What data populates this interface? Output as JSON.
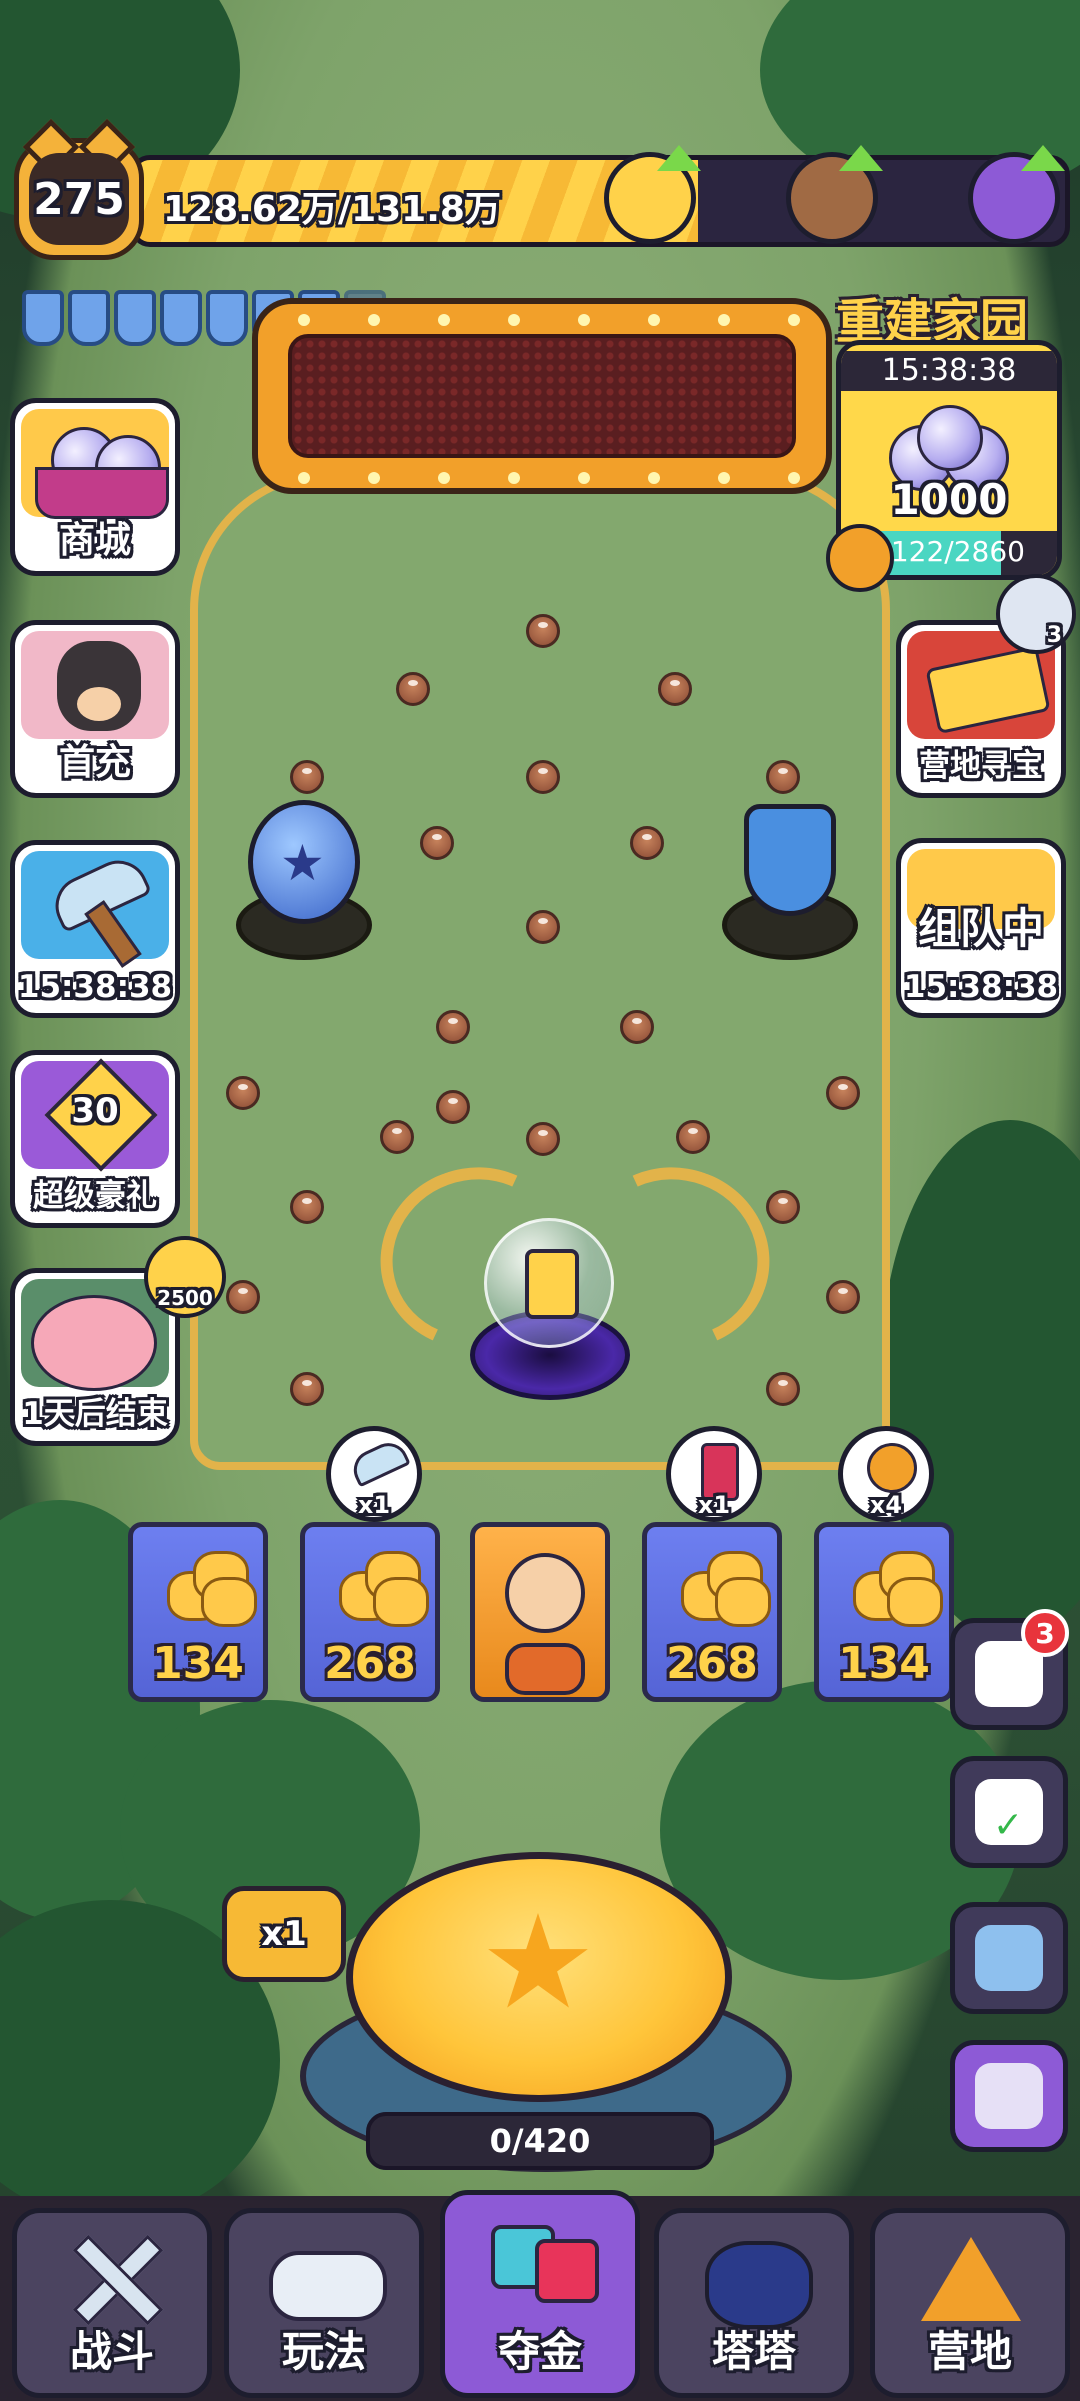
{
  "player": {
    "level": "275"
  },
  "xp": {
    "text": "128.62万/131.8万",
    "fraction": 0.976
  },
  "shields": {
    "total": 8,
    "active": 7
  },
  "side_left": [
    {
      "label": "商城",
      "icon": "gem-basket-icon"
    },
    {
      "label": "首充",
      "icon": "dog-character-icon"
    },
    {
      "label": "15:38:38",
      "icon": "hammer-icon"
    },
    {
      "label": "超级豪礼",
      "icon": "level-30-gift-icon",
      "level": "30"
    },
    {
      "label": "1天后结束",
      "icon": "piggy-bank-icon",
      "bubble": "2500"
    }
  ],
  "rebuild": {
    "title": "重建家园",
    "timer": "15:38:38",
    "amount": "1000",
    "progress": "2122/2860",
    "fraction": 0.742
  },
  "side_right": [
    {
      "label": "营地寻宝",
      "badge": "3",
      "icon": "treasure-chest-icon"
    },
    {
      "label": "组队中",
      "timer": "15:38:38",
      "icon": "checkered-flag-icon"
    }
  ],
  "bonus_items": [
    {
      "icon": "hammer-icon",
      "mult": "x1"
    },
    {
      "icon": "energy-can-icon",
      "mult": "x1"
    },
    {
      "icon": "screw-bolt-icon",
      "mult": "x4"
    }
  ],
  "slots": [
    "134",
    "268",
    "",
    "268",
    "134"
  ],
  "right_controls": {
    "chat_badge": "3"
  },
  "drop": {
    "multiplier": "x1",
    "counter": "0/420"
  },
  "nav": [
    {
      "label": "战斗",
      "icon": "crossed-swords-icon"
    },
    {
      "label": "玩法",
      "icon": "gamepad-icon"
    },
    {
      "label": "夺金",
      "icon": "gold-rush-icon"
    },
    {
      "label": "塔塔",
      "icon": "cat-face-icon"
    },
    {
      "label": "营地",
      "icon": "tent-icon"
    }
  ],
  "colors": {
    "accent": "#ffd24a",
    "nav_active": "#8d5ad6",
    "slot_blue": "#6d7ff0"
  }
}
